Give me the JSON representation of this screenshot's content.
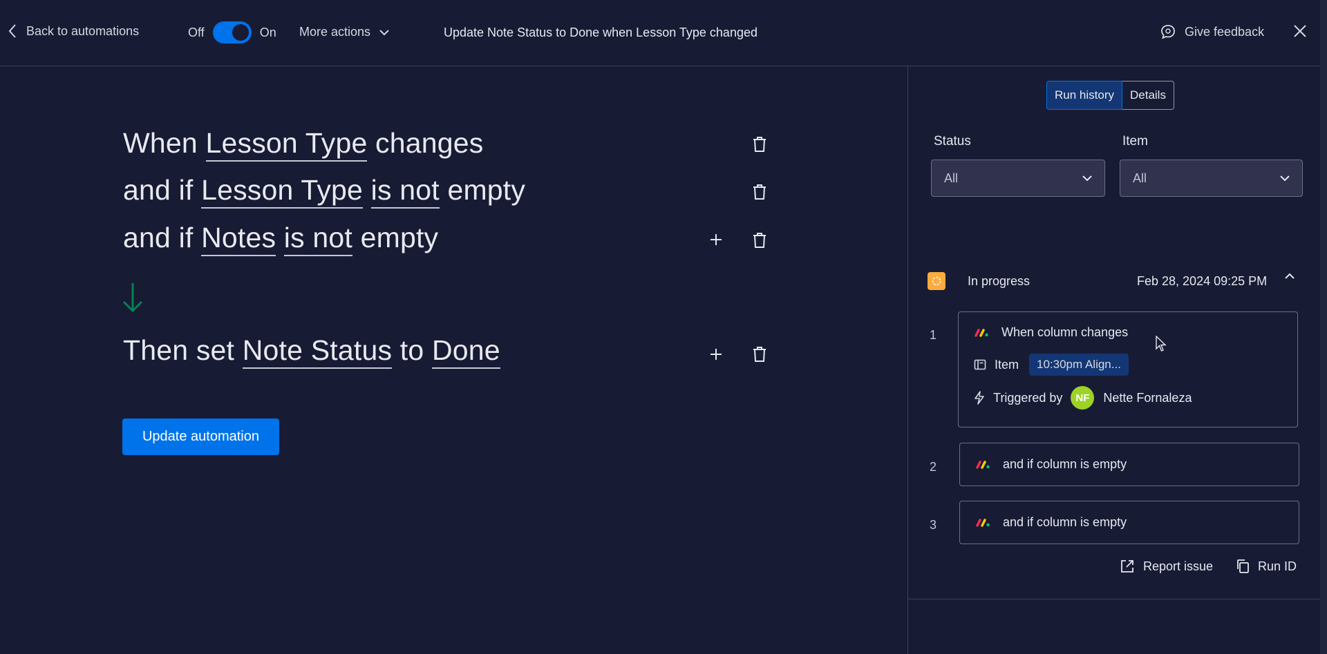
{
  "header": {
    "back_label": "Back to automations",
    "toggle_off_label": "Off",
    "toggle_on_label": "On",
    "more_actions_label": "More actions",
    "title": "Update Note Status to Done when Lesson Type changed",
    "feedback_label": "Give feedback"
  },
  "editor": {
    "line1": {
      "w1": "When",
      "k1": "Lesson Type",
      "w2": "changes"
    },
    "line2": {
      "w1": "and if",
      "k1": "Lesson Type",
      "k2": "is not",
      "w2": "empty"
    },
    "line3": {
      "w1": "and if",
      "k1": "Notes",
      "k2": "is not",
      "w2": "empty"
    },
    "line4": {
      "w1": "Then set",
      "k1": "Note Status",
      "w2": "to",
      "k2": "Done"
    },
    "update_button": "Update automation"
  },
  "panel": {
    "tabs": [
      "Run history",
      "Details"
    ],
    "filters": {
      "status_label": "Status",
      "status_value": "All",
      "item_label": "Item",
      "item_value": "All"
    },
    "run": {
      "status": "In progress",
      "date": "Feb 28, 2024 09:25 PM",
      "steps": [
        {
          "num": "1",
          "title": "When column changes",
          "item_label": "Item",
          "item_value": "10:30pm Align...",
          "triggered_label": "Triggered by",
          "user_initials": "NF",
          "user_name": "Nette Fornaleza"
        },
        {
          "num": "2",
          "title": "and if column is empty"
        },
        {
          "num": "3",
          "title": "and if column is empty"
        }
      ]
    },
    "report_issue": "Report issue",
    "run_id": "Run ID"
  },
  "colors": {
    "background": "#181b34",
    "primary": "#0073ea",
    "in_progress": "#fdab3d",
    "arrow": "#00854d",
    "avatar": "#9cd326"
  }
}
